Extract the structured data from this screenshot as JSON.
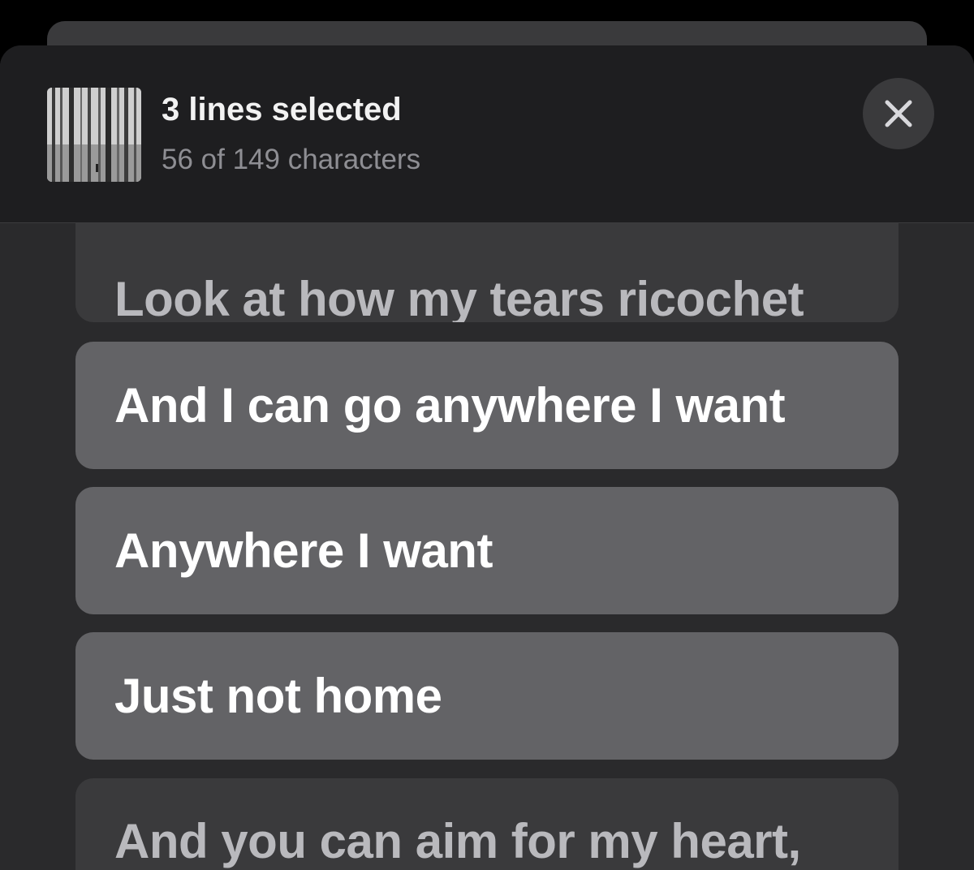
{
  "header": {
    "title": "3 lines selected",
    "subtitle": "56 of 149 characters",
    "artwork_icon": "album-artwork-forest",
    "close_icon": "close-icon"
  },
  "lyrics": [
    {
      "text": "Look at how my tears ricochet",
      "selected": false
    },
    {
      "text": "And I can go anywhere I want",
      "selected": true
    },
    {
      "text": "Anywhere I want",
      "selected": true
    },
    {
      "text": "Just not home",
      "selected": true
    },
    {
      "text": "And you can aim for my heart,",
      "selected": false
    }
  ],
  "colors": {
    "background": "#000000",
    "sheet": "#2a2a2c",
    "header": "#1e1e20",
    "card_selected": "#636366",
    "card_unselected": "#3a3a3c",
    "text_selected": "#ffffff",
    "text_unselected": "#b9b9bd",
    "subtitle": "#8e8e93"
  }
}
